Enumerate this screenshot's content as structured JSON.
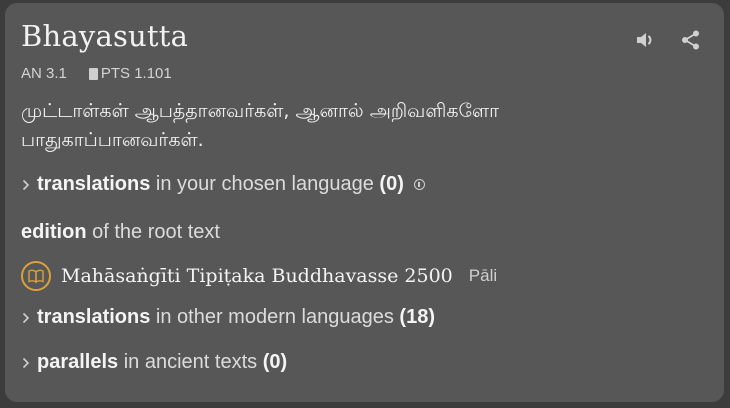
{
  "sutta": {
    "title": "Bhayasutta",
    "id": "AN 3.1",
    "pts": "PTS 1.101",
    "blurb": "முட்டாள்கள் ஆபத்தானவர்கள், ஆனால் அறிவளிகளோ பாதுகாப்பானவர்கள்."
  },
  "icons": {
    "audio": "speaker-icon",
    "share": "share-icon",
    "info": "info-icon",
    "book": "book-icon"
  },
  "translations_chosen": {
    "bold": "translations",
    "rest": " in your chosen language ",
    "count": "(0)"
  },
  "edition": {
    "bold": "edition",
    "rest": " of the root text"
  },
  "root_text": {
    "title": "Mahāsaṅgīti Tipiṭaka Buddhavasse 2500",
    "lang": "Pāli"
  },
  "translations_other": {
    "bold": "translations",
    "rest": " in other modern languages ",
    "count": "(18)"
  },
  "parallels": {
    "bold": "parallels",
    "rest": " in ancient texts ",
    "count": "(0)"
  },
  "colors": {
    "card": "#575757",
    "background": "#3c3c3c",
    "accent": "#d8a23a"
  }
}
